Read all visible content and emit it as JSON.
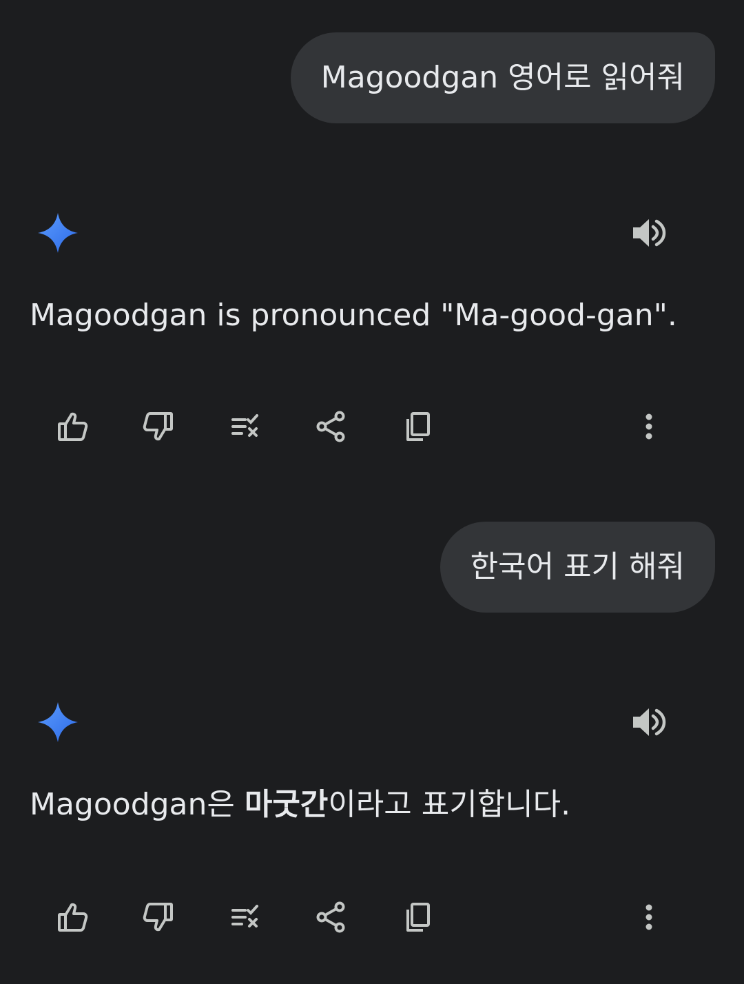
{
  "conversation": [
    {
      "user_message": "Magoodgan 영어로 읽어줘",
      "response": {
        "text_before": "Magoodgan is pronounced \"Ma-good-gan\".",
        "bold": "",
        "text_after": ""
      }
    },
    {
      "user_message": "한국어 표기 해줘",
      "response": {
        "text_before": "Magoodgan은 ",
        "bold": "마굿간",
        "text_after": "이라고 표기합니다."
      }
    }
  ],
  "icons": {
    "assistant": "gemini-sparkle-icon",
    "speaker": "volume-icon",
    "actions": [
      "thumbs-up-icon",
      "thumbs-down-icon",
      "modify-response-icon",
      "share-icon",
      "copy-icon",
      "more-vert-icon"
    ]
  },
  "colors": {
    "background": "#1c1d1f",
    "bubble": "#333538",
    "text": "#e8eaed",
    "icon": "#c4c7c5",
    "sparkle_start": "#4b90ff",
    "sparkle_end": "#2f6fe8"
  }
}
